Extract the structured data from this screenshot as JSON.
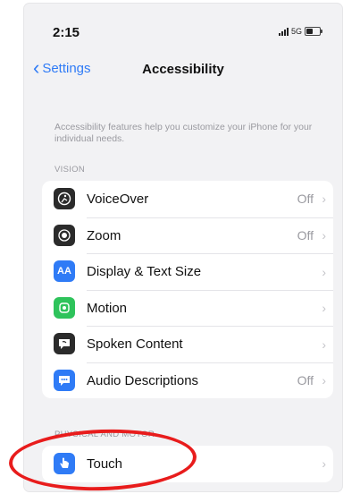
{
  "status": {
    "time": "2:15",
    "network": "5G"
  },
  "nav": {
    "back_label": "Settings",
    "title": "Accessibility"
  },
  "intro": "Accessibility features help you customize your iPhone for your individual needs.",
  "sections": {
    "vision_header": "VISION",
    "physical_header": "PHYSICAL AND MOTOR"
  },
  "vision_items": [
    {
      "label": "VoiceOver",
      "value": "Off",
      "icon": "voiceover-icon"
    },
    {
      "label": "Zoom",
      "value": "Off",
      "icon": "zoom-icon"
    },
    {
      "label": "Display & Text Size",
      "value": "",
      "icon": "text-size-icon",
      "icon_text": "AA"
    },
    {
      "label": "Motion",
      "value": "",
      "icon": "motion-icon"
    },
    {
      "label": "Spoken Content",
      "value": "",
      "icon": "spoken-content-icon"
    },
    {
      "label": "Audio Descriptions",
      "value": "Off",
      "icon": "audio-descriptions-icon"
    }
  ],
  "physical_items": [
    {
      "label": "Touch",
      "value": "",
      "icon": "touch-icon"
    }
  ],
  "colors": {
    "accent": "#2f7bf6",
    "motion_green": "#2ec35b",
    "dark_icon": "#2b2b2b",
    "highlight_red": "#e81c1c"
  }
}
